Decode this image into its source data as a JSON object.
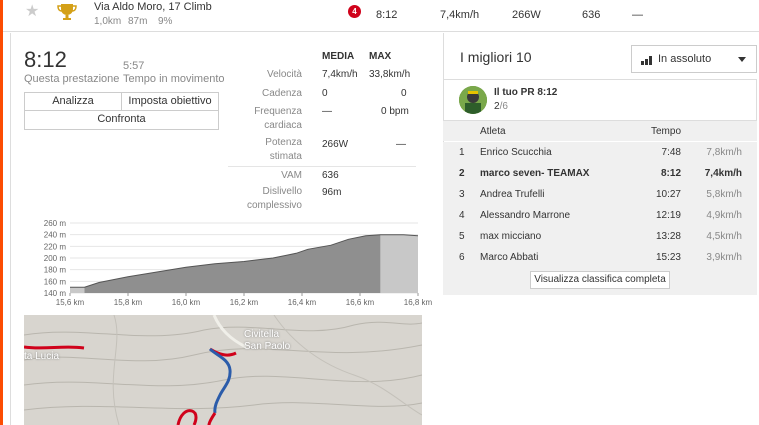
{
  "segment_row": {
    "name": "Via Aldo Moro, 17 Climb",
    "distance": "1,0km",
    "elevation": "87m",
    "grade": "9%",
    "rank_badge": "4",
    "time": "8:12",
    "speed": "7,4km/h",
    "power": "266W",
    "vam": "636",
    "hr": "—"
  },
  "effort": {
    "time": "8:12",
    "time_label": "Questa prestazione",
    "moving_time": "5:57",
    "moving_label": "Tempo in movimento",
    "buttons": {
      "analyze": "Analizza",
      "set_goal": "Imposta obiettivo",
      "compare": "Confronta"
    }
  },
  "stats": {
    "header_avg": "MEDIA",
    "header_max": "MAX",
    "rows": [
      {
        "label": "Velocità",
        "avg": "7,4km/h",
        "max": "33,8km/h"
      },
      {
        "label": "Cadenza",
        "avg": "0",
        "max": "0"
      },
      {
        "label": "Frequenza cardiaca",
        "avg": "—",
        "max": "0 bpm"
      },
      {
        "label": "Potenza stimata",
        "avg": "266W",
        "max": "—"
      },
      {
        "label": "VAM",
        "avg": "636",
        "max": ""
      },
      {
        "label": "Dislivello complessivo",
        "avg": "96m",
        "max": ""
      }
    ]
  },
  "chart_data": {
    "type": "area",
    "title": "",
    "xlabel": "",
    "ylabel": "",
    "x_unit": "km",
    "y_unit": "m",
    "ylim": [
      140,
      260
    ],
    "xlim": [
      15.6,
      16.8
    ],
    "x_ticks": [
      "15,6 km",
      "15,8 km",
      "16,0 km",
      "16,2 km",
      "16,4 km",
      "16,6 km",
      "16,8 km"
    ],
    "y_ticks": [
      "260 m",
      "240 m",
      "220 m",
      "200 m",
      "180 m",
      "160 m",
      "140 m"
    ],
    "highlight_range": [
      15.65,
      16.67
    ],
    "x": [
      15.55,
      15.65,
      15.7,
      15.8,
      15.9,
      16.0,
      16.1,
      16.2,
      16.3,
      16.38,
      16.42,
      16.5,
      16.56,
      16.62,
      16.67,
      16.75,
      16.85
    ],
    "y": [
      150,
      150,
      158,
      168,
      176,
      184,
      190,
      194,
      200,
      208,
      215,
      222,
      232,
      238,
      240,
      240,
      238
    ],
    "colors": {
      "fill": "#c8c8c8",
      "highlight_fill": "#8f8f8f",
      "line": "#555555"
    }
  },
  "leaderboard": {
    "title": "I migliori 10",
    "filter": "In assoluto",
    "pr_label": "Il tuo PR 8:12",
    "pr_rank": "2",
    "pr_total": "/6",
    "col_athlete": "Atleta",
    "col_time": "Tempo",
    "rows": [
      {
        "rank": "1",
        "name": "Enrico Scucchia",
        "time": "7:48",
        "speed": "7,8km/h",
        "bold": false
      },
      {
        "rank": "2",
        "name": "marco seven- TEAMAX",
        "time": "8:12",
        "speed": "7,4km/h",
        "bold": true
      },
      {
        "rank": "3",
        "name": "Andrea Trufelli",
        "time": "10:27",
        "speed": "5,8km/h",
        "bold": false
      },
      {
        "rank": "4",
        "name": "Alessandro Marrone",
        "time": "12:19",
        "speed": "4,9km/h",
        "bold": false
      },
      {
        "rank": "5",
        "name": "max micciano",
        "time": "13:28",
        "speed": "4,5km/h",
        "bold": false
      },
      {
        "rank": "6",
        "name": "Marco Abbati",
        "time": "15:23",
        "speed": "3,9km/h",
        "bold": false
      }
    ],
    "view_all": "Visualizza classifica completa"
  },
  "map": {
    "labels": [
      "Civitella",
      "San Paolo",
      "ta Lucia"
    ]
  },
  "icons": {
    "star": "star-icon",
    "trophy": "trophy-icon",
    "chart": "bar-chart-icon",
    "caret": "caret-down-icon"
  },
  "colors": {
    "accent": "#fc4c02",
    "badge": "#d0021b",
    "route_red": "#d0021b",
    "route_blue": "#2b5caa",
    "trophy": "#d4a017"
  }
}
